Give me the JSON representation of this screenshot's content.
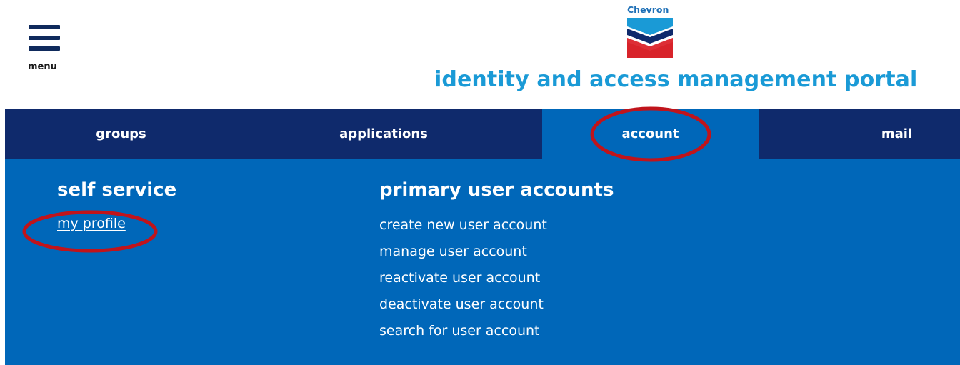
{
  "header": {
    "menu_label": "menu",
    "logo_text": "Chevron",
    "portal_title": "identity and access management portal"
  },
  "tabs": [
    {
      "label": "groups"
    },
    {
      "label": "applications"
    },
    {
      "label": "account",
      "active": true
    },
    {
      "label": "mail"
    }
  ],
  "panel": {
    "self_service": {
      "heading": "self service",
      "links": [
        "my profile"
      ]
    },
    "primary_user_accounts": {
      "heading": "primary user accounts",
      "links": [
        "create new user account",
        "manage user account",
        "reactivate user account",
        "deactivate user account",
        "search for user account"
      ]
    }
  },
  "colors": {
    "nav_dark": "#0f2a6c",
    "nav_active": "#0067b9",
    "title_blue": "#1a9ad6",
    "annotation_red": "#c0141b"
  },
  "icons": {
    "menu": "hamburger-icon",
    "logo": "chevron-logo"
  }
}
